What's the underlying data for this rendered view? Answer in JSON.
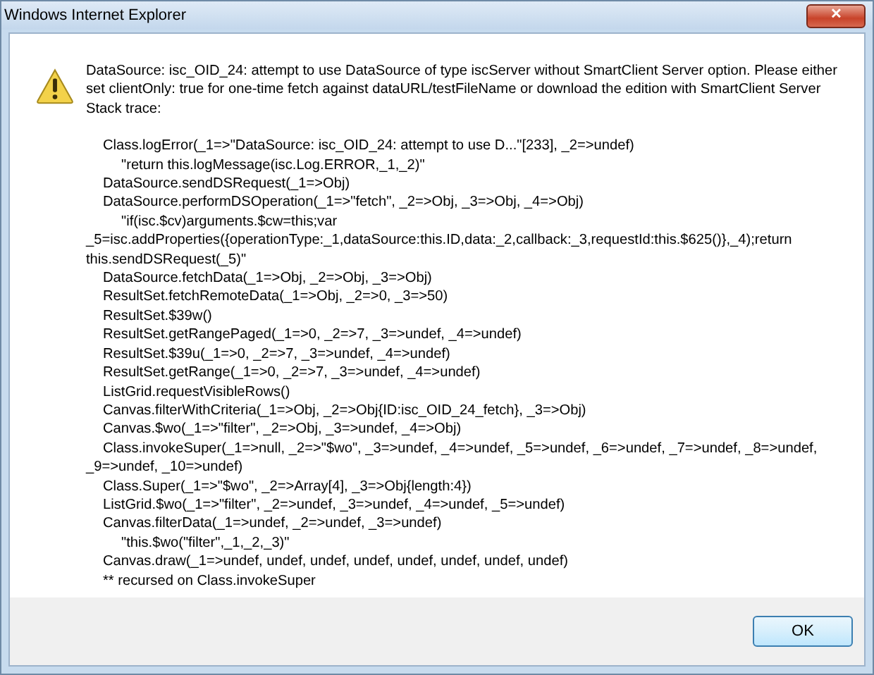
{
  "window": {
    "title": "Windows Internet Explorer",
    "close": "✕"
  },
  "message": [
    "DataSource: isc_OID_24: attempt to use DataSource of type iscServer without SmartClient Server option. Please either",
    "set clientOnly: true for one-time fetch against dataURL/testFileName or download the edition with SmartClient Server",
    "Stack trace:"
  ],
  "trace": [
    {
      "kind": "frame",
      "text": "Class.logError(_1=>\"DataSource: isc_OID_24: attempt to use D...\"[233], _2=>undef)"
    },
    {
      "kind": "source",
      "text": "\"return this.logMessage(isc.Log.ERROR,_1,_2)\""
    },
    {
      "kind": "frame",
      "text": "DataSource.sendDSRequest(_1=>Obj)"
    },
    {
      "kind": "frame",
      "text": "DataSource.performDSOperation(_1=>\"fetch\", _2=>Obj, _3=>Obj, _4=>Obj)"
    },
    {
      "kind": "source",
      "text": "\"if(isc.$cv)arguments.$cw=this;var"
    },
    {
      "kind": "wrap",
      "text": "_5=isc.addProperties({operationType:_1,dataSource:this.ID,data:_2,callback:_3,requestId:this.$625()},_4);return"
    },
    {
      "kind": "wrap",
      "text": "this.sendDSRequest(_5)\""
    },
    {
      "kind": "frame",
      "text": "DataSource.fetchData(_1=>Obj, _2=>Obj, _3=>Obj)"
    },
    {
      "kind": "frame",
      "text": "ResultSet.fetchRemoteData(_1=>Obj, _2=>0, _3=>50)"
    },
    {
      "kind": "frame",
      "text": "ResultSet.$39w()"
    },
    {
      "kind": "frame",
      "text": "ResultSet.getRangePaged(_1=>0, _2=>7, _3=>undef, _4=>undef)"
    },
    {
      "kind": "frame",
      "text": "ResultSet.$39u(_1=>0, _2=>7, _3=>undef, _4=>undef)"
    },
    {
      "kind": "frame",
      "text": "ResultSet.getRange(_1=>0, _2=>7, _3=>undef, _4=>undef)"
    },
    {
      "kind": "frame",
      "text": "ListGrid.requestVisibleRows()"
    },
    {
      "kind": "frame",
      "text": "Canvas.filterWithCriteria(_1=>Obj, _2=>Obj{ID:isc_OID_24_fetch}, _3=>Obj)"
    },
    {
      "kind": "frame",
      "text": "Canvas.$wo(_1=>\"filter\", _2=>Obj, _3=>undef, _4=>Obj)"
    },
    {
      "kind": "frame",
      "text": "Class.invokeSuper(_1=>null, _2=>\"$wo\", _3=>undef, _4=>undef, _5=>undef, _6=>undef, _7=>undef, _8=>undef,"
    },
    {
      "kind": "wrap",
      "text": "_9=>undef, _10=>undef)"
    },
    {
      "kind": "frame",
      "text": "Class.Super(_1=>\"$wo\", _2=>Array[4], _3=>Obj{length:4})"
    },
    {
      "kind": "frame",
      "text": "ListGrid.$wo(_1=>\"filter\", _2=>undef, _3=>undef, _4=>undef, _5=>undef)"
    },
    {
      "kind": "frame",
      "text": "Canvas.filterData(_1=>undef, _2=>undef, _3=>undef)"
    },
    {
      "kind": "source",
      "text": "\"this.$wo(\"filter\",_1,_2,_3)\""
    },
    {
      "kind": "frame",
      "text": "Canvas.draw(_1=>undef, undef, undef, undef, undef, undef, undef, undef)"
    },
    {
      "kind": "frame",
      "text": "** recursed on Class.invokeSuper"
    }
  ],
  "buttons": [
    "OK"
  ]
}
